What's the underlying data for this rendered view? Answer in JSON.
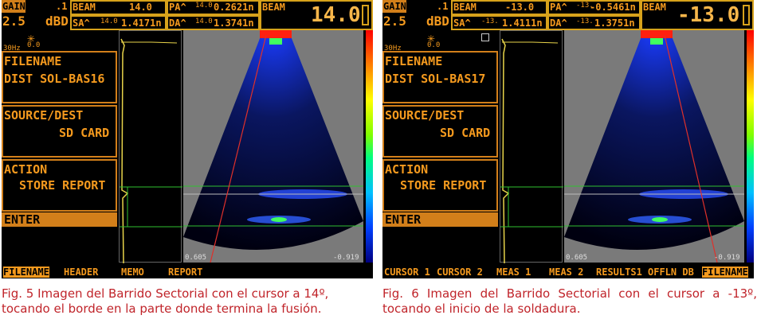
{
  "panels": [
    {
      "gain_label": "GAIN",
      "gain_step": ".1",
      "gain_value": "2.5",
      "gain_unit": "dBD",
      "beam_label": "BEAM",
      "beam_value": "14.0",
      "pa_label": "PA^",
      "pa_small": "14.0",
      "pa_value": "0.2621n",
      "beam_label2": "BEAM",
      "big_value": "14.0",
      "sa_label": "SA^",
      "sa_small": "14.0",
      "sa_value": "1.4171n",
      "da_label": "DA^",
      "da_small": "14.0",
      "da_value": "1.3741n",
      "hz": "30Hz",
      "zero": "0.0",
      "filename_label": "FILENAME",
      "filename_value": "DIST SOL-BAS16",
      "source_label": "SOURCE/DEST",
      "source_value": "SD CARD",
      "action_label": "ACTION",
      "action_value": "STORE REPORT",
      "enter_label": "ENTER",
      "axis_left": "0.605",
      "axis_right": "-0.919",
      "bottom_tabs": [
        "FILENAME",
        "HEADER",
        "MEMO",
        "REPORT"
      ],
      "selected_tab": 0,
      "caption": "Fig. 5 Imagen del Barrido Sectorial con el cursor a 14º, tocando el borde en la parte donde termina la fusión."
    },
    {
      "gain_label": "GAIN",
      "gain_step": ".1",
      "gain_value": "2.5",
      "gain_unit": "dBD",
      "beam_label": "BEAM",
      "beam_value": "-13.0",
      "pa_label": "PA^",
      "pa_small": "-13.",
      "pa_value": "-0.5461n",
      "beam_label2": "BEAM",
      "big_value": "-13.0",
      "sa_label": "SA^",
      "sa_small": "-13.",
      "sa_value": "1.4111n",
      "da_label": "DA^",
      "da_small": "-13.",
      "da_value": "1.3751n",
      "hz": "30Hz",
      "zero": "0.0",
      "filename_label": "FILENAME",
      "filename_value": "DIST SOL-BAS17",
      "source_label": "SOURCE/DEST",
      "source_value": "SD CARD",
      "action_label": "ACTION",
      "action_value": "STORE REPORT",
      "enter_label": "ENTER",
      "axis_left": "0.605",
      "axis_right": "-0.919",
      "bottom_tabs": [
        "CURSOR 1",
        "CURSOR 2",
        "MEAS 1",
        "MEAS 2",
        "RESULTS1",
        "OFFLN DB",
        "FILENAME"
      ],
      "selected_tab": 6,
      "caption": "Fig. 6 Imagen del Barrido Sectorial con el cursor a -13º, tocando el inicio de la soldadura."
    }
  ],
  "colors": {
    "accent": "#f59a1e",
    "caption": "#c0242a",
    "cursor_line": "#e0302a",
    "gate_line": "#30c030",
    "scan_bg": "#7a7a7a"
  }
}
